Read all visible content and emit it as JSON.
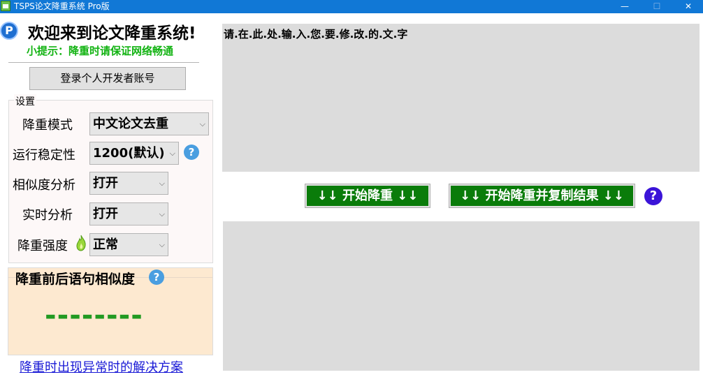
{
  "window": {
    "title": "TSPS论文降重系统 Pro版",
    "controls": {
      "minimize": "—",
      "maximize": "☐",
      "close": "✕"
    }
  },
  "header": {
    "logo_letter": "P",
    "welcome": "欢迎来到论文降重系统!",
    "tip": "小提示：降重时请保证网络畅通"
  },
  "login_button": "登录个人开发者账号",
  "settings": {
    "legend": "设置",
    "mode": {
      "label": "降重模式",
      "value": "中文论文去重"
    },
    "stability": {
      "label": "运行稳定性",
      "value": "1200(默认)"
    },
    "similarity_analysis": {
      "label": "相似度分析",
      "value": "打开"
    },
    "realtime_analysis": {
      "label": "实时分析",
      "value": "打开"
    },
    "strength": {
      "label": "降重强度",
      "value": "正常"
    }
  },
  "similarity": {
    "title": "降重前后语句相似度",
    "value": "--------"
  },
  "help_symbol": "?",
  "chevron": "⌵",
  "solution_link": "降重时出现异常时的解决方案",
  "input_area": {
    "text": "请.在.此.处.输.入.您.要.修.改.的.文.字"
  },
  "buttons": {
    "start": "↓↓ 开始降重 ↓↓",
    "start_copy": "↓↓ 开始降重并复制结果 ↓↓"
  },
  "colors": {
    "titlebar": "#1178d6",
    "tip_green": "#12b312",
    "button_green": "#0a7c0a",
    "similarity_dashes": "#219a21",
    "help_blue": "#4a9ee0",
    "help_purple": "#3b14d8",
    "link_blue": "#1a1ad6",
    "text_area_gray": "#dcdcdc",
    "similarity_panel": "#fde9d0"
  }
}
